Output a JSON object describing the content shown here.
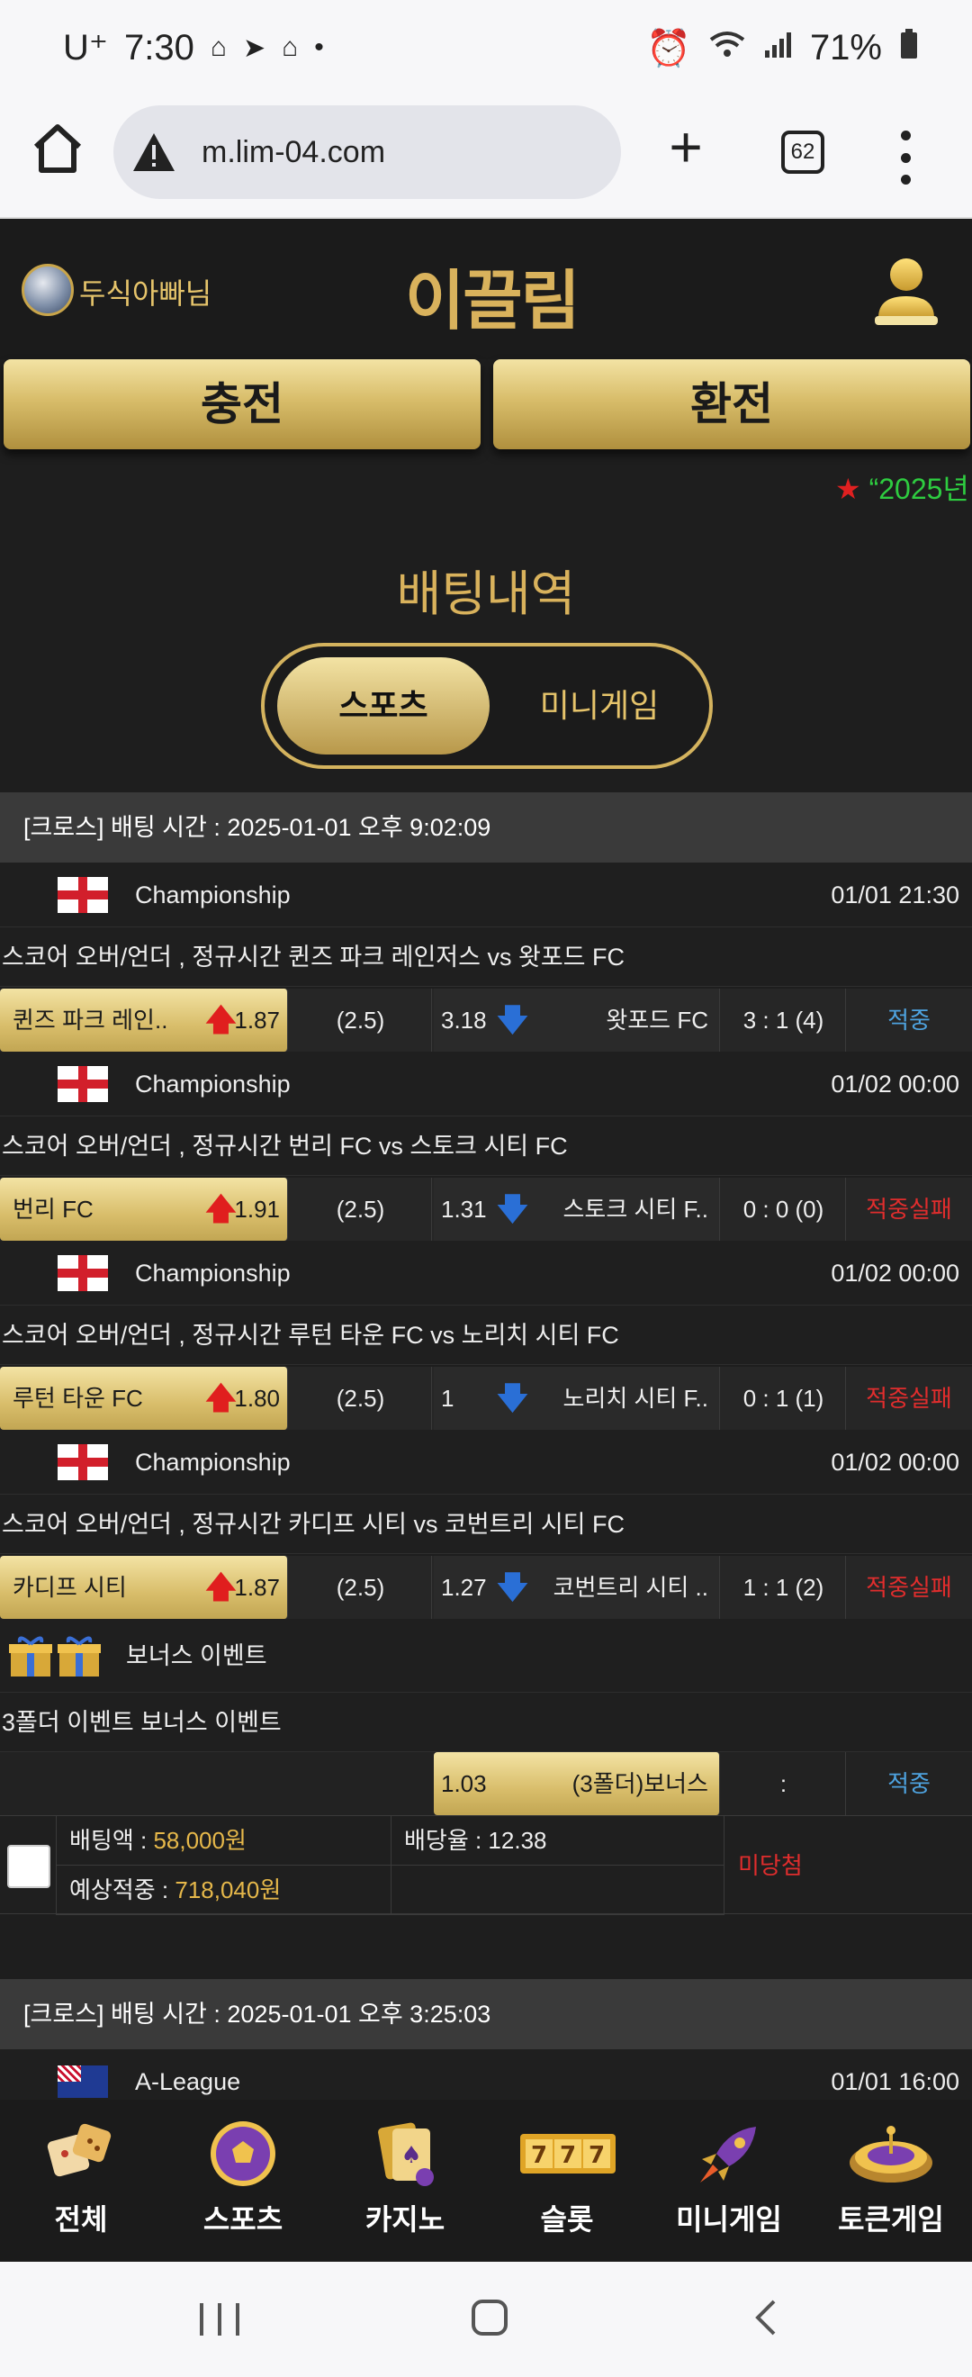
{
  "status_bar": {
    "carrier": "U⁺",
    "time": "7:30",
    "notif_icons": [
      "easy-home-icon",
      "telegram-icon",
      "easy-home-icon",
      "dot-icon"
    ],
    "battery": "71%"
  },
  "browser": {
    "url": "m.lim-04.com",
    "tab_count": "62"
  },
  "site": {
    "username": "두식아빠님",
    "logo_text": "이끌림",
    "charge_label": "충전",
    "exchange_label": "환전",
    "ticker_star": "★",
    "ticker_text": "“2025년",
    "section_title": "배팅내역",
    "tab_sports": "스포츠",
    "tab_minigame": "미니게임"
  },
  "bet_slip_1": {
    "header": "[크로스] 배팅 시간 : 2025-01-01 오후 9:02:09",
    "matches": [
      {
        "league": "Championship",
        "kickoff": "01/01 21:30",
        "title": "스코어 오버/언더 , 정규시간 퀸즈 파크 레인저스  vs  왓포드 FC",
        "home": "퀸즈 파크 레인..",
        "home_odds": "1.87",
        "line": "(2.5)",
        "away_odds": "3.18",
        "away": "왓포드 FC",
        "score": "3 : 1 (4)",
        "result": "적중",
        "result_type": "win"
      },
      {
        "league": "Championship",
        "kickoff": "01/02 00:00",
        "title": "스코어 오버/언더 , 정규시간 번리 FC  vs  스토크 시티 FC",
        "home": "번리 FC",
        "home_odds": "1.91",
        "line": "(2.5)",
        "away_odds": "1.31",
        "away": "스토크 시티 F..",
        "score": "0 : 0 (0)",
        "result": "적중실패",
        "result_type": "lose"
      },
      {
        "league": "Championship",
        "kickoff": "01/02 00:00",
        "title": "스코어 오버/언더 , 정규시간 루턴 타운 FC  vs  노리치 시티 FC",
        "home": "루턴 타운 FC",
        "home_odds": "1.80",
        "line": "(2.5)",
        "away_odds": "1",
        "away": "노리치 시티 F..",
        "score": "0 : 1 (1)",
        "result": "적중실패",
        "result_type": "lose"
      },
      {
        "league": "Championship",
        "kickoff": "01/02 00:00",
        "title": "스코어 오버/언더 , 정규시간 카디프 시티  vs  코번트리 시티 FC",
        "home": "카디프 시티",
        "home_odds": "1.87",
        "line": "(2.5)",
        "away_odds": "1.27",
        "away": "코번트리 시티 ..",
        "score": "1 : 1 (2)",
        "result": "적중실패",
        "result_type": "lose"
      }
    ],
    "bonus": {
      "label": "보너스 이벤트",
      "title": "3폴더 이벤트 보너스 이벤트",
      "odds": "1.03",
      "name": "(3폴더)보너스",
      "score": ":",
      "result": "적중"
    },
    "summary": {
      "bet_amount_label": "배팅액 : ",
      "bet_amount": "58,000원",
      "odds_label": "배당율 : 12.38",
      "expected_label": "예상적중 : ",
      "expected": "718,040원",
      "status": "미당첨"
    }
  },
  "bet_slip_2": {
    "header": "[크로스] 배팅 시간 : 2025-01-01 오후 3:25:03",
    "league": "A-League",
    "kickoff": "01/01 16:00"
  },
  "game_nav": [
    {
      "label": "전체",
      "icon": "dice-icon"
    },
    {
      "label": "스포츠",
      "icon": "soccer-ball-icon"
    },
    {
      "label": "카지노",
      "icon": "cards-icon"
    },
    {
      "label": "슬롯",
      "icon": "slot-777-icon"
    },
    {
      "label": "미니게임",
      "icon": "rocket-icon"
    },
    {
      "label": "토큰게임",
      "icon": "roulette-icon"
    }
  ],
  "colors": {
    "gold": "#d9b25c",
    "win_blue": "#4ea3e0",
    "lose_red": "#e02d2d",
    "up_arrow": "#e01e1e",
    "down_arrow": "#2a6fd6"
  }
}
